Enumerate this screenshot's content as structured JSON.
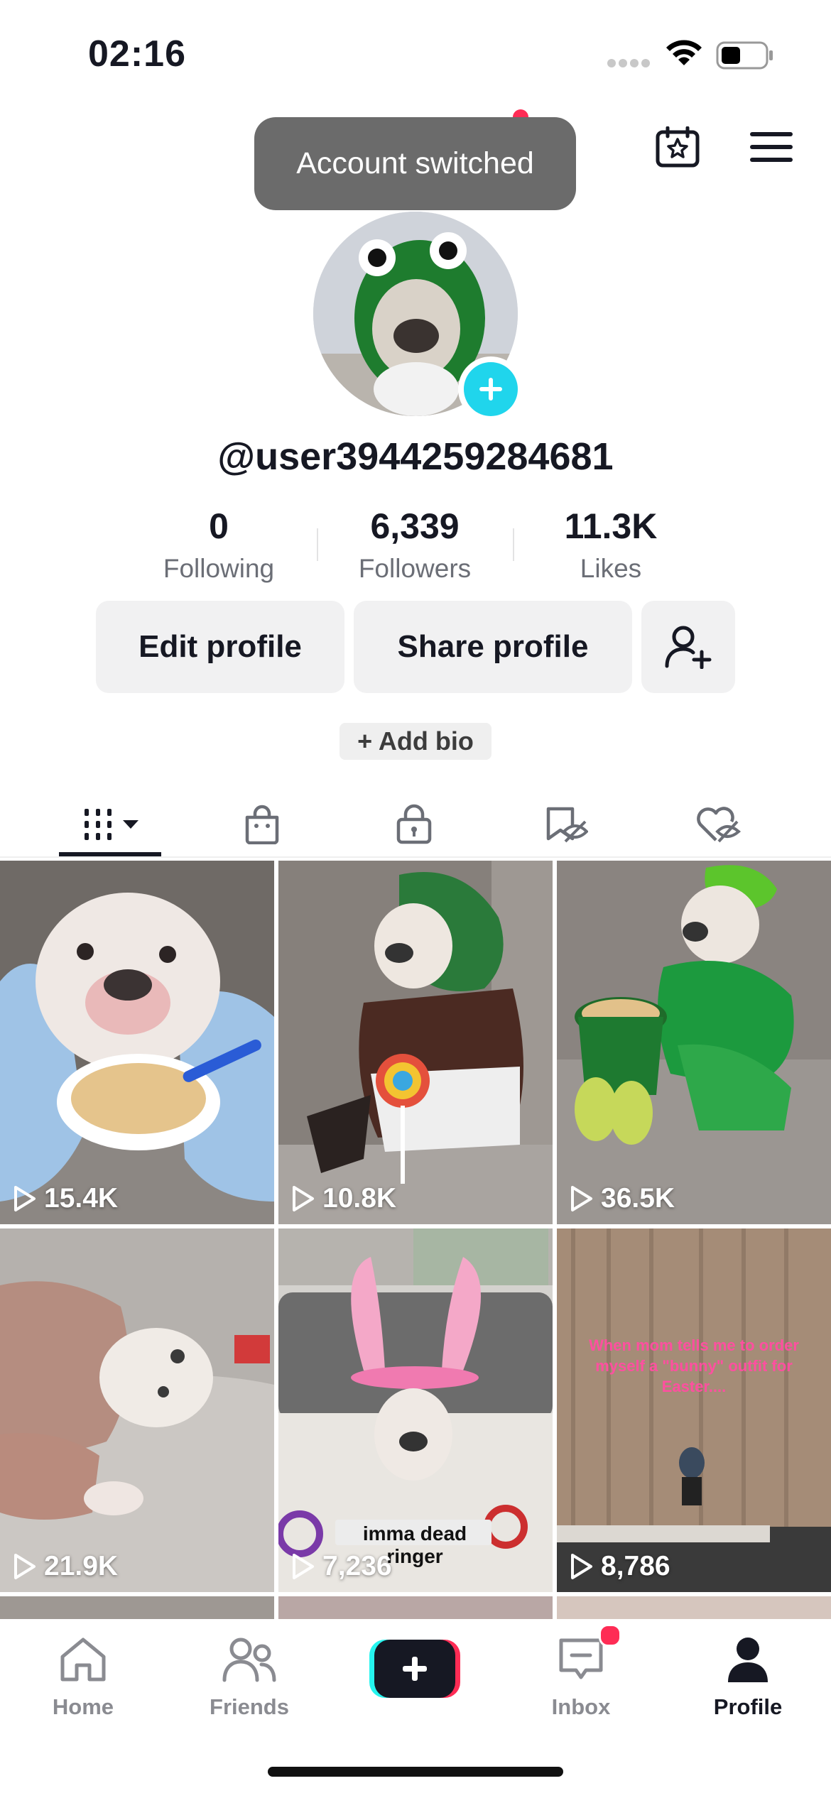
{
  "status_bar": {
    "time": "02:16"
  },
  "toast": {
    "text": "Account switched"
  },
  "profile": {
    "username": "@user3944259284681",
    "stats": [
      {
        "value": "0",
        "label": "Following"
      },
      {
        "value": "6,339",
        "label": "Followers"
      },
      {
        "value": "11.3K",
        "label": "Likes"
      }
    ],
    "edit_label": "Edit profile",
    "share_label": "Share profile",
    "add_bio_label": "+ Add bio"
  },
  "tabs": [
    {
      "icon": "grid-icon",
      "selected": true
    },
    {
      "icon": "shop-bag-icon"
    },
    {
      "icon": "lock-icon"
    },
    {
      "icon": "hidden-bookmark-icon"
    },
    {
      "icon": "hidden-heart-icon"
    }
  ],
  "videos": [
    {
      "views": "15.4K"
    },
    {
      "views": "10.8K"
    },
    {
      "views": "36.5K"
    },
    {
      "views": "21.9K"
    },
    {
      "views": "7,236",
      "caption": "imma dead ringer"
    },
    {
      "views": "8,786",
      "caption": "When mom tells me to order myself a \"bunny\" outfit for Easter...."
    }
  ],
  "nav": {
    "home": "Home",
    "friends": "Friends",
    "inbox": "Inbox",
    "profile": "Profile"
  },
  "colors": {
    "accent_pink": "#fe2c55",
    "accent_cyan": "#20d5ec",
    "text_primary": "#161823",
    "text_secondary": "#6b6e76"
  }
}
